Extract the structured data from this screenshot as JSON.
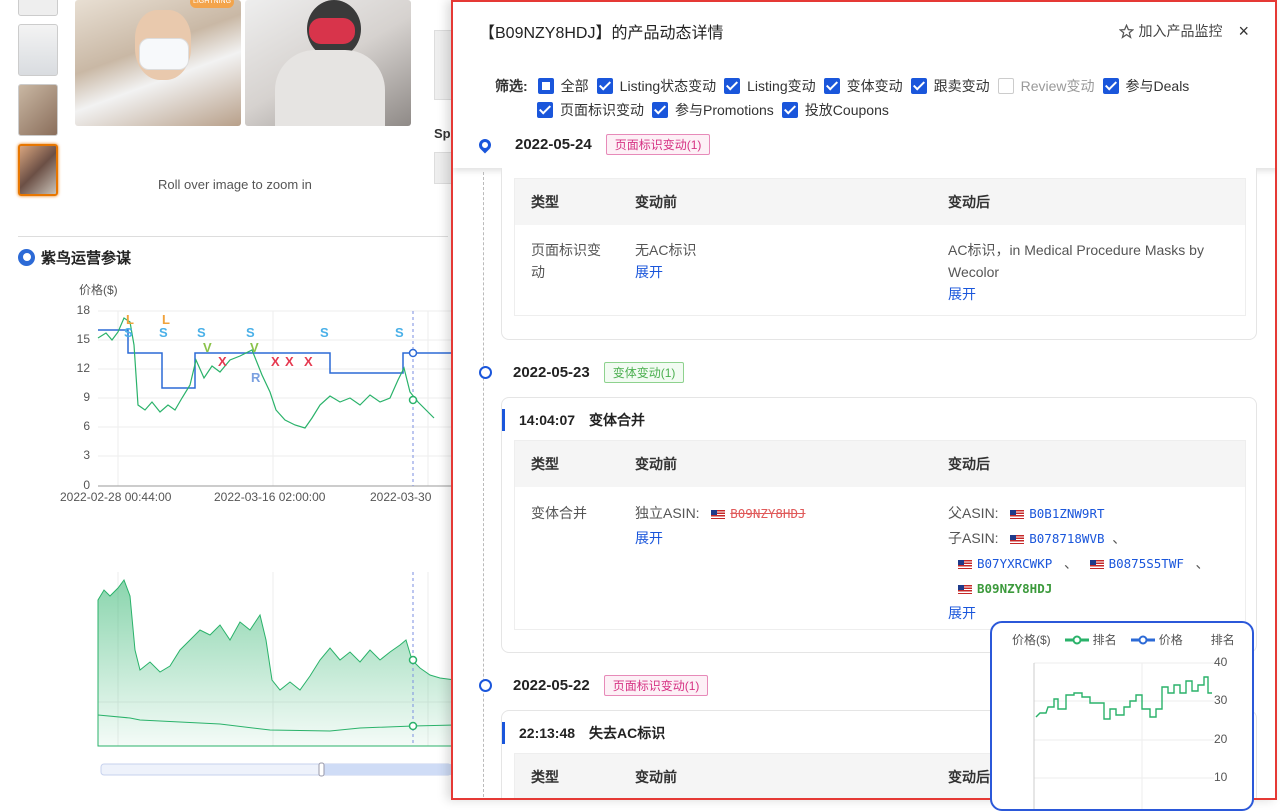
{
  "dialog": {
    "title": "【B09NZY8HDJ】的产品动态详情",
    "monitor_label": "加入产品监控",
    "close_glyph": "×"
  },
  "filters": {
    "label": "筛选:",
    "row1": [
      {
        "label": "全部",
        "state": "partial"
      },
      {
        "label": "Listing状态变动",
        "state": "checked"
      },
      {
        "label": "Listing变动",
        "state": "checked"
      },
      {
        "label": "变体变动",
        "state": "checked"
      },
      {
        "label": "跟卖变动",
        "state": "checked"
      },
      {
        "label": "Review变动",
        "state": "unchecked"
      },
      {
        "label": "参与Deals",
        "state": "checked"
      }
    ],
    "row2": [
      {
        "label": "页面标识变动",
        "state": "checked"
      },
      {
        "label": "参与Promotions",
        "state": "checked"
      },
      {
        "label": "投放Coupons",
        "state": "checked"
      }
    ]
  },
  "events": [
    {
      "date": "2022-05-24",
      "tag": "页面标识变动(1)",
      "headers": [
        "类型",
        "变动前",
        "变动后"
      ],
      "type": "页面标识变动",
      "before": "无AC标识",
      "after": "AC标识，in Medical Procedure Masks by Wecolor",
      "expand": "展开"
    },
    {
      "date": "2022-05-23",
      "tag": "变体变动(1)",
      "time": "14:04:07",
      "title": "变体合并",
      "headers": [
        "类型",
        "变动前",
        "变动后"
      ],
      "type": "变体合并",
      "before_label": "独立ASIN:",
      "before_asin": "B09NZY8HDJ",
      "parent_label": "父ASIN:",
      "parent_asin": "B0B1ZNW9RT",
      "child_label": "子ASIN:",
      "child_asins": [
        "B078718WVB",
        "B07YXRCWKP",
        "B0875S5TWF",
        "B09NZY8HDJ"
      ],
      "separator": "、",
      "expand": "展开"
    },
    {
      "date": "2022-05-22",
      "tag": "页面标识变动(1)",
      "time": "22:13:48",
      "title": "失去AC标识",
      "headers": [
        "类型",
        "变动前",
        "变动后"
      ]
    }
  ],
  "background": {
    "zoom_hint": "Roll over image to zoom in",
    "brand": "紫鸟运营参谋",
    "price_axis_title": "价格($)",
    "y_ticks": [
      "18",
      "15",
      "12",
      "9",
      "6",
      "3",
      "0"
    ],
    "x_ticks": [
      "2022-02-28 00:44:00",
      "2022-03-16 02:00:00",
      "2022-03-30"
    ],
    "sp_label": "Sp",
    "badge": "LIGHTNING",
    "markers": [
      "L",
      "L",
      "S",
      "S",
      "S",
      "S",
      "S",
      "V",
      "V",
      "R",
      "X",
      "X",
      "X",
      "X"
    ]
  },
  "mini_chart": {
    "legend_price_axis": "价格($)",
    "legend_rank": "排名",
    "legend_price": "价格",
    "right_axis": "排名",
    "ticks": [
      "40",
      "30",
      "20",
      "10"
    ],
    "colors": {
      "rank": "#2ab26a",
      "price": "#2c6ad6"
    }
  }
}
